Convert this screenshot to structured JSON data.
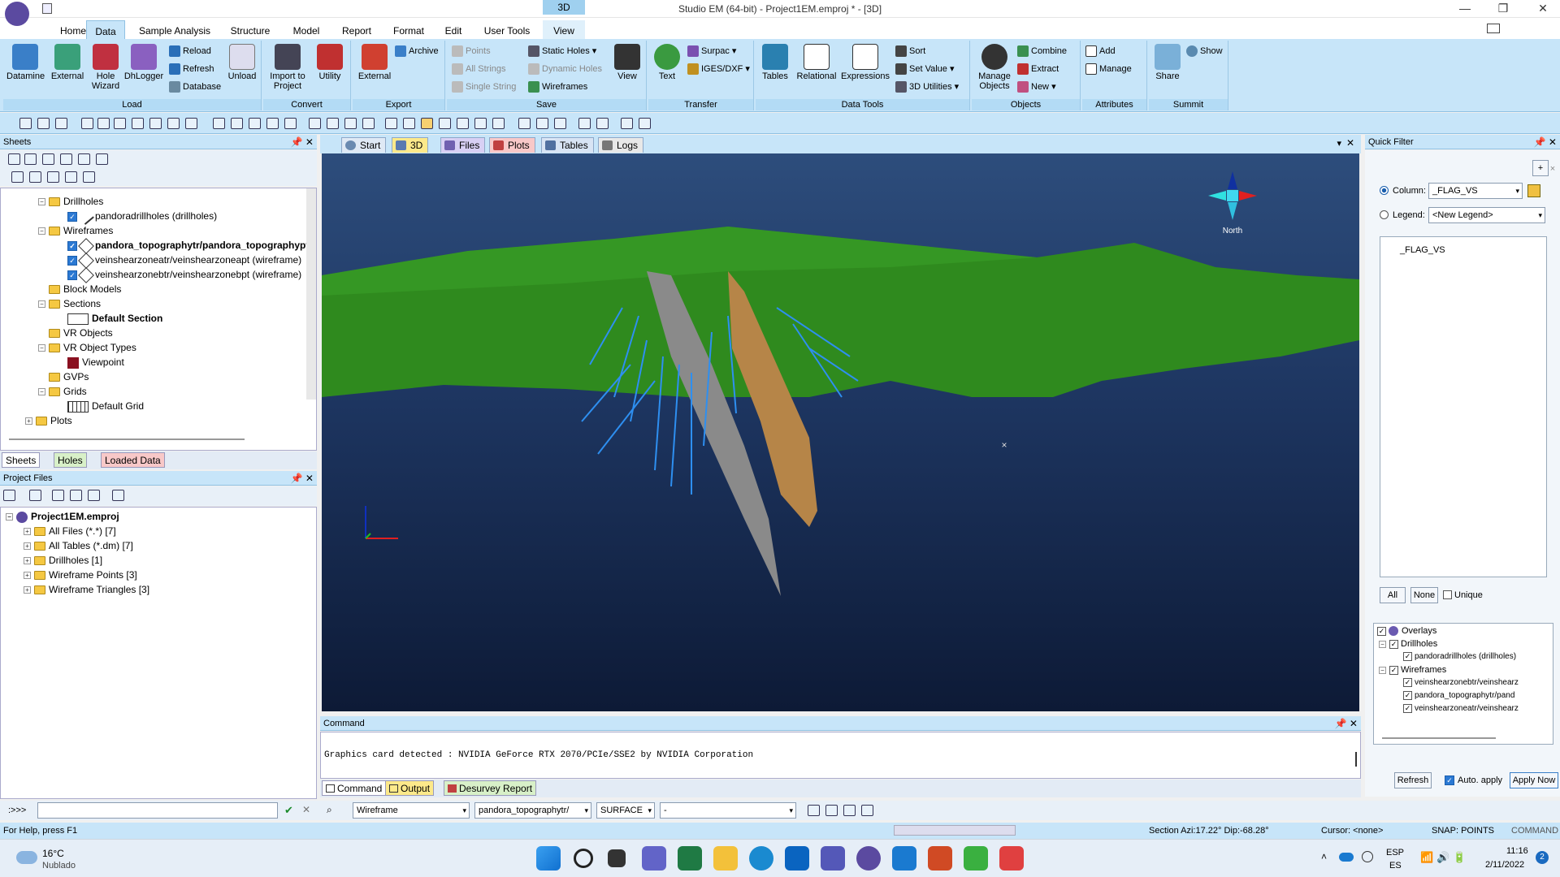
{
  "window": {
    "title": "Studio EM (64-bit) - Project1EM.emproj * - [3D]",
    "context_tab": "3D"
  },
  "ribbon_tabs": [
    "Home",
    "Data",
    "Sample Analysis",
    "Structure",
    "Model",
    "Report",
    "Format",
    "Edit",
    "User Tools",
    "View"
  ],
  "active_tab": "Data",
  "ribbon": {
    "load": {
      "label": "Load",
      "datamine": "Datamine",
      "external": "External",
      "hole_wizard": "Hole Wizard",
      "dhlogger": "DhLogger",
      "reload": "Reload",
      "refresh": "Refresh",
      "database": "Database",
      "unload": "Unload"
    },
    "convert": {
      "label": "Convert",
      "import_to_project": "Import to Project",
      "utility": "Utility"
    },
    "export": {
      "label": "Export",
      "external": "External",
      "archive": "Archive"
    },
    "save": {
      "label": "Save",
      "points": "Points",
      "all_strings": "All Strings",
      "single_string": "Single String",
      "static_holes": "Static Holes",
      "dynamic_holes": "Dynamic Holes",
      "wireframes": "Wireframes",
      "view": "View"
    },
    "transfer": {
      "label": "Transfer",
      "text": "Text",
      "surpac": "Surpac",
      "iges_dxf": "IGES/DXF"
    },
    "data_tools": {
      "label": "Data Tools",
      "tables": "Tables",
      "relational": "Relational",
      "expressions": "Expressions",
      "sort": "Sort",
      "set_value": "Set Value",
      "3d_utilities": "3D Utilities"
    },
    "objects": {
      "label": "Objects",
      "manage_objects": "Manage Objects",
      "combine": "Combine",
      "extract": "Extract",
      "new": "New"
    },
    "attributes": {
      "label": "Attributes",
      "add": "Add",
      "manage": "Manage"
    },
    "summit": {
      "label": "Summit",
      "share": "Share",
      "show": "Show"
    }
  },
  "sheets": {
    "title": "Sheets",
    "tree": [
      {
        "label": "Drillholes",
        "kind": "folder"
      },
      {
        "label": "pandoradrillholes (drillholes)",
        "kind": "item"
      },
      {
        "label": "Wireframes",
        "kind": "folder"
      },
      {
        "label": "pandora_topographytr/pandora_topographypt",
        "kind": "item"
      },
      {
        "label": "veinshearzoneatr/veinshearzoneapt (wireframe)",
        "kind": "item"
      },
      {
        "label": "veinshearzonebtr/veinshearzonebpt (wireframe)",
        "kind": "item"
      },
      {
        "label": "Block Models",
        "kind": "folder"
      },
      {
        "label": "Sections",
        "kind": "folder"
      },
      {
        "label": "Default Section",
        "kind": "item"
      },
      {
        "label": "VR Objects",
        "kind": "folder"
      },
      {
        "label": "VR Object Types",
        "kind": "folder"
      },
      {
        "label": "Viewpoint",
        "kind": "item"
      },
      {
        "label": "GVPs",
        "kind": "folder"
      },
      {
        "label": "Grids",
        "kind": "folder"
      },
      {
        "label": "Default Grid",
        "kind": "item"
      },
      {
        "label": "Plots",
        "kind": "folder"
      }
    ],
    "tabs": [
      "Sheets",
      "Holes",
      "Loaded Data"
    ]
  },
  "project_files": {
    "title": "Project Files",
    "root": "Project1EM.emproj",
    "items": [
      "All Files (*.*) [7]",
      "All Tables (*.dm) [7]",
      "Drillholes [1]",
      "Wireframe Points [3]",
      "Wireframe Triangles [3]"
    ]
  },
  "view_tabs": [
    "Start",
    "3D",
    "Files",
    "Plots",
    "Tables",
    "Logs"
  ],
  "compass_label": "North",
  "command": {
    "title": "Command",
    "output": "Graphics card detected : NVIDIA GeForce RTX 2070/PCIe/SSE2 by NVIDIA Corporation",
    "tabs": [
      "Command",
      "Output",
      "Desurvey Report"
    ]
  },
  "cmdbar": {
    "prompt": ":>>>",
    "type_value": "Wireframe",
    "object_value": "pandora_topographytr/",
    "surface_value": "SURFACE",
    "dash_value": "-"
  },
  "quick_filter": {
    "title": "Quick Filter",
    "column_label": "Column:",
    "column_value": "_FLAG_VS",
    "legend_label": "Legend:",
    "legend_value": "<New Legend>",
    "list_items": [
      "_FLAG_VS"
    ],
    "all_btn": "All",
    "none_btn": "None",
    "unique_label": "Unique",
    "overlays": [
      {
        "label": "Overlays",
        "level": 0
      },
      {
        "label": "Drillholes",
        "level": 1
      },
      {
        "label": "pandoradrillholes (drillholes)",
        "level": 2
      },
      {
        "label": "Wireframes",
        "level": 1
      },
      {
        "label": "veinshearzonebtr/veinshearz",
        "level": 2
      },
      {
        "label": "pandora_topographytr/pand",
        "level": 2
      },
      {
        "label": "veinshearzoneatr/veinshearz",
        "level": 2
      }
    ],
    "refresh_btn": "Refresh",
    "auto_apply_label": "Auto. apply",
    "apply_now_btn": "Apply Now"
  },
  "status": {
    "help": "For Help, press F1",
    "section": "Section Azi:17.22° Dip:-68.28°",
    "cursor": "Cursor: <none>",
    "snap": "SNAP: POINTS",
    "mode": "COMMAND"
  },
  "taskbar": {
    "weather_temp": "16°C",
    "weather_desc": "Nublado",
    "lang1": "ESP",
    "lang2": "ES",
    "time": "11:16",
    "date": "2/11/2022",
    "notif": "2"
  }
}
